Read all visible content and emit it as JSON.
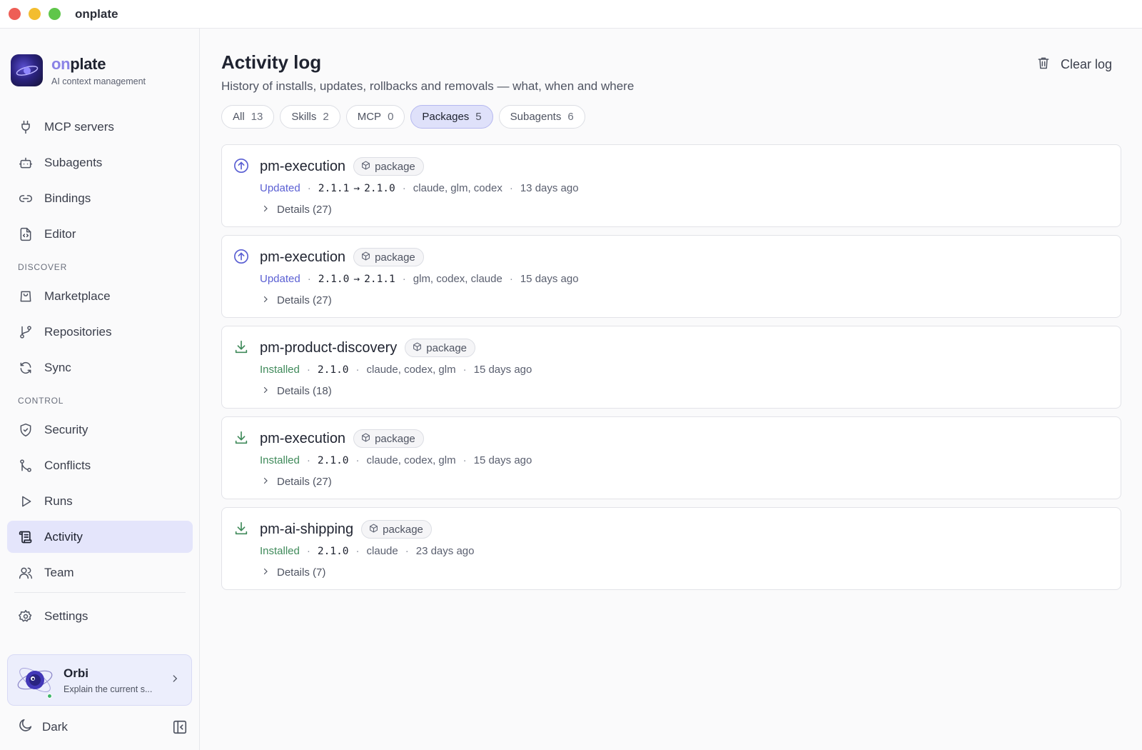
{
  "app": {
    "title": "onplate"
  },
  "brand": {
    "name_prefix": "on",
    "name_suffix": "plate",
    "subtitle": "AI context management"
  },
  "sidebar": {
    "items": [
      {
        "label": "MCP servers",
        "icon": "plug-icon"
      },
      {
        "label": "Subagents",
        "icon": "bot-icon"
      },
      {
        "label": "Bindings",
        "icon": "link-icon"
      },
      {
        "label": "Editor",
        "icon": "file-code-icon"
      }
    ],
    "discover_label": "DISCOVER",
    "discover": [
      {
        "label": "Marketplace",
        "icon": "shopping-bag-icon"
      },
      {
        "label": "Repositories",
        "icon": "git-branch-icon"
      },
      {
        "label": "Sync",
        "icon": "refresh-icon"
      }
    ],
    "control_label": "CONTROL",
    "control": [
      {
        "label": "Security",
        "icon": "shield-icon"
      },
      {
        "label": "Conflicts",
        "icon": "git-merge-icon"
      },
      {
        "label": "Runs",
        "icon": "play-icon"
      },
      {
        "label": "Activity",
        "icon": "scroll-icon",
        "active": true
      },
      {
        "label": "Team",
        "icon": "users-icon"
      }
    ],
    "settings_label": "Settings"
  },
  "orbi": {
    "name": "Orbi",
    "subtitle": "Explain the current s..."
  },
  "footer": {
    "theme_label": "Dark"
  },
  "main": {
    "title": "Activity log",
    "subtitle": "History of installs, updates, rollbacks and removals — what, when and where",
    "clear_label": "Clear log",
    "filters": [
      {
        "label": "All",
        "count": "13"
      },
      {
        "label": "Skills",
        "count": "2"
      },
      {
        "label": "MCP",
        "count": "0"
      },
      {
        "label": "Packages",
        "count": "5",
        "active": true
      },
      {
        "label": "Subagents",
        "count": "6"
      }
    ],
    "entries": [
      {
        "name": "pm-execution",
        "badge": "package",
        "status": "Updated",
        "kind": "updated",
        "from": "2.1.1",
        "to": "2.1.0",
        "targets": "claude, glm, codex",
        "when": "13 days ago",
        "details": "Details (27)"
      },
      {
        "name": "pm-execution",
        "badge": "package",
        "status": "Updated",
        "kind": "updated",
        "from": "2.1.0",
        "to": "2.1.1",
        "targets": "glm, codex, claude",
        "when": "15 days ago",
        "details": "Details (27)"
      },
      {
        "name": "pm-product-discovery",
        "badge": "package",
        "status": "Installed",
        "kind": "installed",
        "from": "2.1.0",
        "to": "",
        "targets": "claude, codex, glm",
        "when": "15 days ago",
        "details": "Details (18)"
      },
      {
        "name": "pm-execution",
        "badge": "package",
        "status": "Installed",
        "kind": "installed",
        "from": "2.1.0",
        "to": "",
        "targets": "claude, codex, glm",
        "when": "15 days ago",
        "details": "Details (27)"
      },
      {
        "name": "pm-ai-shipping",
        "badge": "package",
        "status": "Installed",
        "kind": "installed",
        "from": "2.1.0",
        "to": "",
        "targets": "claude",
        "when": "23 days ago",
        "details": "Details (7)"
      }
    ]
  },
  "colors": {
    "accent": "#5a5fd3",
    "installed": "#3f8a5a",
    "active_bg": "#e4e5fb"
  }
}
